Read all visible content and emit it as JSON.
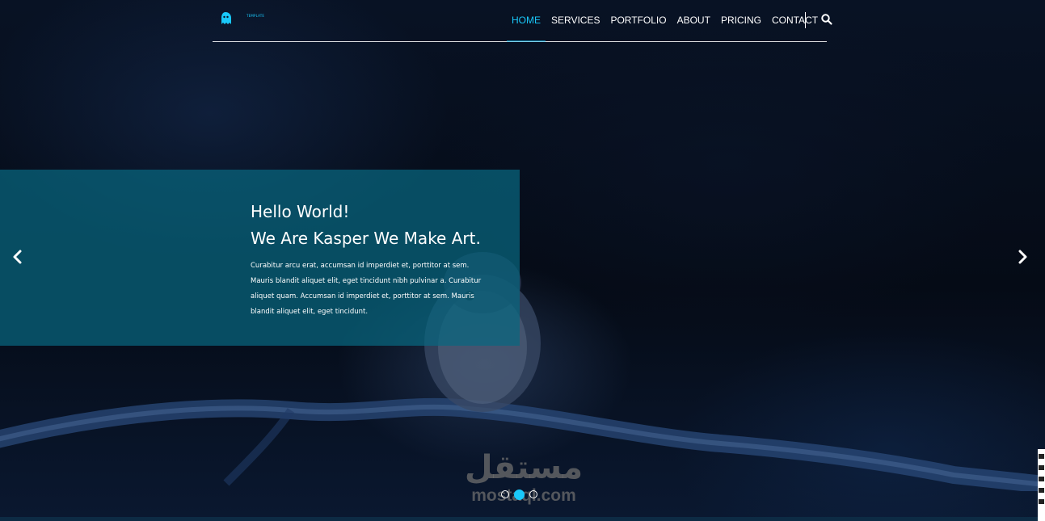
{
  "header": {
    "logo_text": "TEMPLATE",
    "logo_icon": "ghost-icon",
    "nav": [
      {
        "label": "HOME",
        "active": true
      },
      {
        "label": "SERVICES",
        "active": false
      },
      {
        "label": "PORTFOLIO",
        "active": false
      },
      {
        "label": "ABOUT",
        "active": false
      },
      {
        "label": "PRICING",
        "active": false
      },
      {
        "label": "CONTACT",
        "active": false
      }
    ],
    "search_icon": "search-icon"
  },
  "slider": {
    "title_line1": "Hello World!",
    "title_line2": "We Are Kasper We Make Art.",
    "text": "Curabitur arcu erat, accumsan id imperdiet et, porttitor at sem. Mauris blandit aliquet elit, eget tincidunt nibh pulvinar a. Curabitur aliquet quam. Accumsan id imperdiet et, porttitor at sem. Mauris blandit aliquet elit, eget tincidunt.",
    "prev_icon": "chevron-left-icon",
    "next_icon": "chevron-right-icon",
    "slide_count": 3,
    "active_slide": 2
  },
  "watermark": {
    "arabic": "مستقل",
    "latin": "mostaql.com"
  },
  "colors": {
    "accent": "#19c8fa",
    "box": "#086680",
    "text": "#ffffff"
  }
}
